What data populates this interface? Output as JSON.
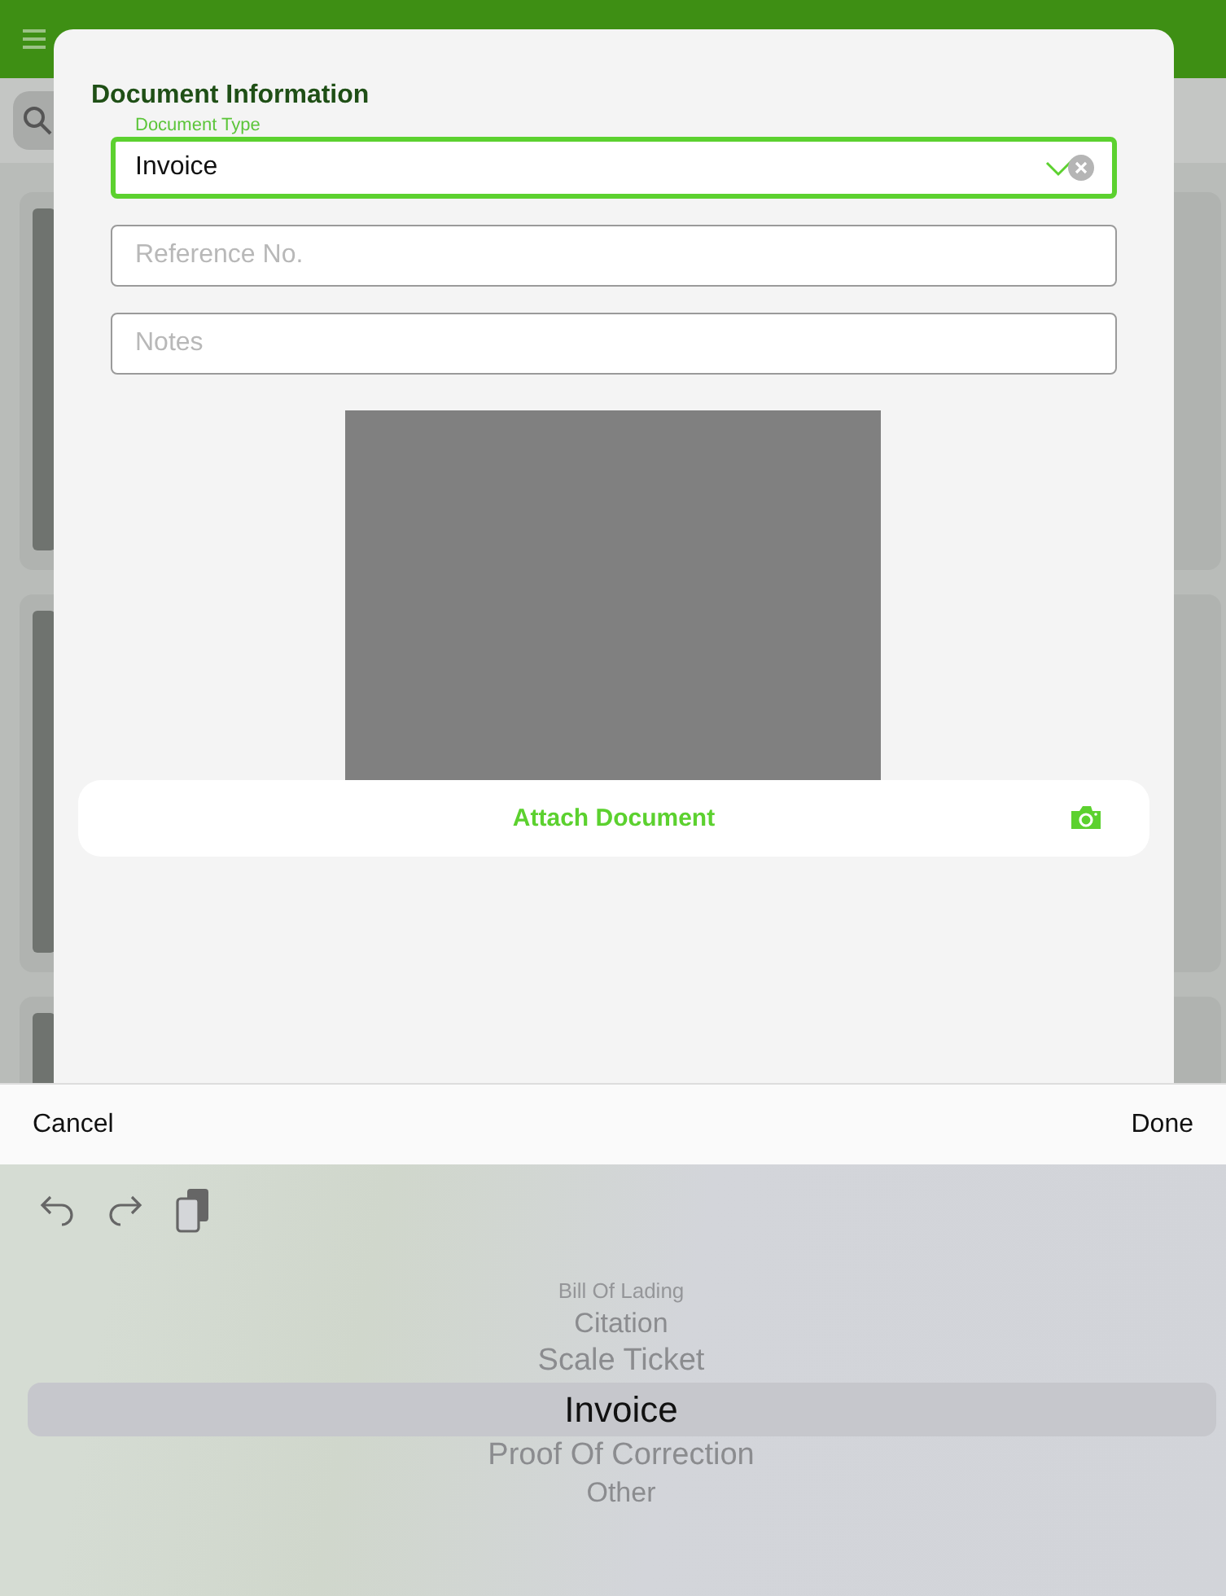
{
  "form": {
    "title": "Document Information",
    "fields": [
      {
        "label": "Document Type",
        "value": "Invoice",
        "focused": true
      },
      {
        "placeholder": "Reference No.",
        "focused": false
      },
      {
        "placeholder": "Notes",
        "focused": false
      }
    ],
    "attach_button": "Attach Document"
  },
  "toolbar": {
    "cancel": "Cancel",
    "done": "Done"
  },
  "picker": {
    "items": [
      {
        "label": "Bill Of Lading",
        "selected": false
      },
      {
        "label": "Citation",
        "selected": false
      },
      {
        "label": "Scale Ticket",
        "selected": false
      },
      {
        "label": "Invoice",
        "selected": true
      },
      {
        "label": "Proof Of Correction",
        "selected": false
      },
      {
        "label": "Other",
        "selected": false
      }
    ]
  }
}
